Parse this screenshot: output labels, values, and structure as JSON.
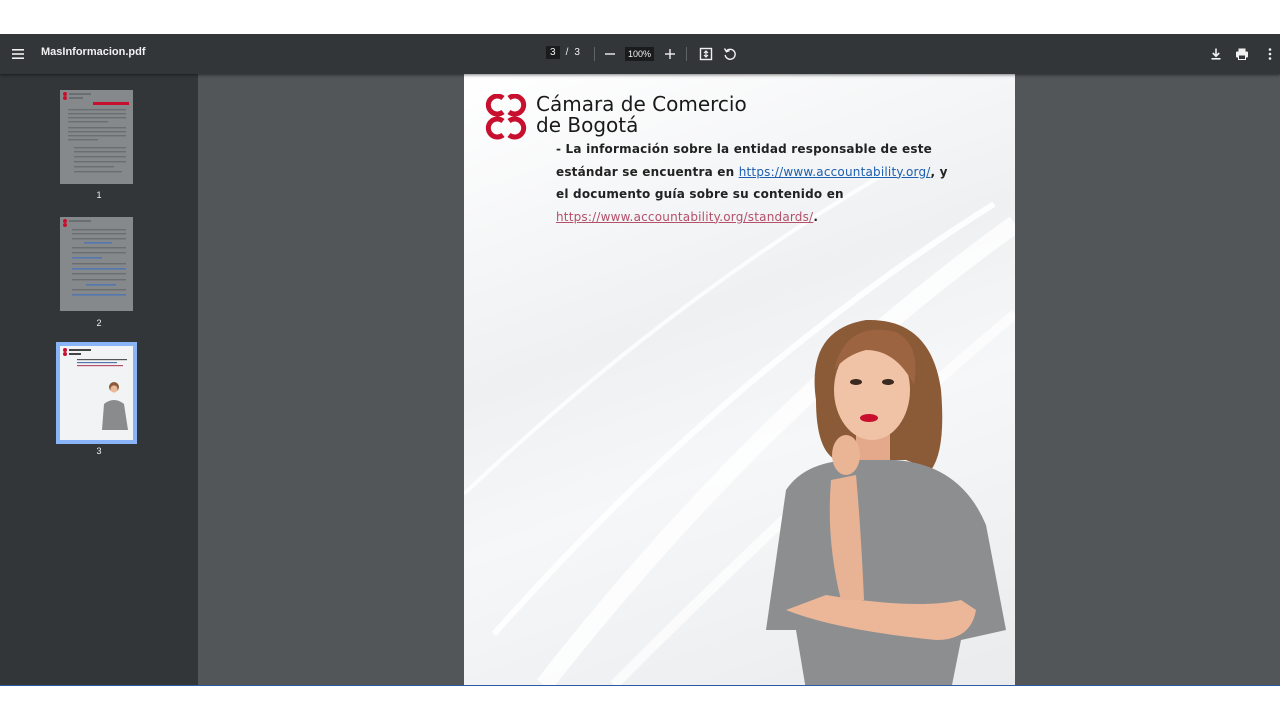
{
  "toolbar": {
    "filename": "MasInformacion.pdf",
    "current_page": "3",
    "page_separator": "/",
    "total_pages": "3",
    "zoom": "100%",
    "icons": [
      "menu-icon",
      "zoom-out-icon",
      "zoom-in-icon",
      "fit-page-icon",
      "rotate-icon",
      "download-icon",
      "print-icon",
      "more-icon"
    ]
  },
  "thumbnails": [
    {
      "label": "1"
    },
    {
      "label": "2"
    },
    {
      "label": "3",
      "selected": true
    }
  ],
  "document": {
    "logo_line1": "Cámara de Comercio",
    "logo_line2": "de Bogotá",
    "text_part1": "- La información sobre la entidad responsable de este estándar se encuentra en ",
    "link1": "https://www.accountability.org/",
    "text_part2": ", y el documento guía sobre su contenido en ",
    "link2": "https://www.accountability.org/standards/",
    "text_part3": "."
  },
  "colors": {
    "toolbar_bg": "#323639",
    "viewer_bg": "#525659",
    "brand_red": "#c8102e",
    "link_blue": "#1c5fb0",
    "link_rose": "#b4506a",
    "selected_thumb": "#8ab4f8"
  }
}
